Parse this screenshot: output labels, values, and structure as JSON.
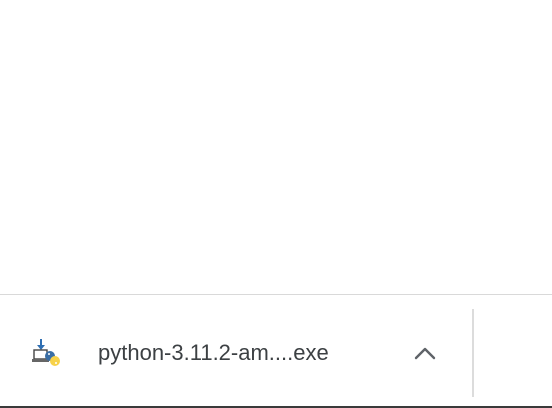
{
  "download_shelf": {
    "items": [
      {
        "file_name": "python-3.11.2-am....exe",
        "icon": "python-installer-icon",
        "menu_icon": "chevron-up-icon"
      }
    ]
  },
  "colors": {
    "shelf_background": "#ffffff",
    "shelf_border": "#d9d9d9",
    "text": "#3c4043",
    "python_blue": "#3a6ea5",
    "python_yellow": "#f7d24a"
  }
}
